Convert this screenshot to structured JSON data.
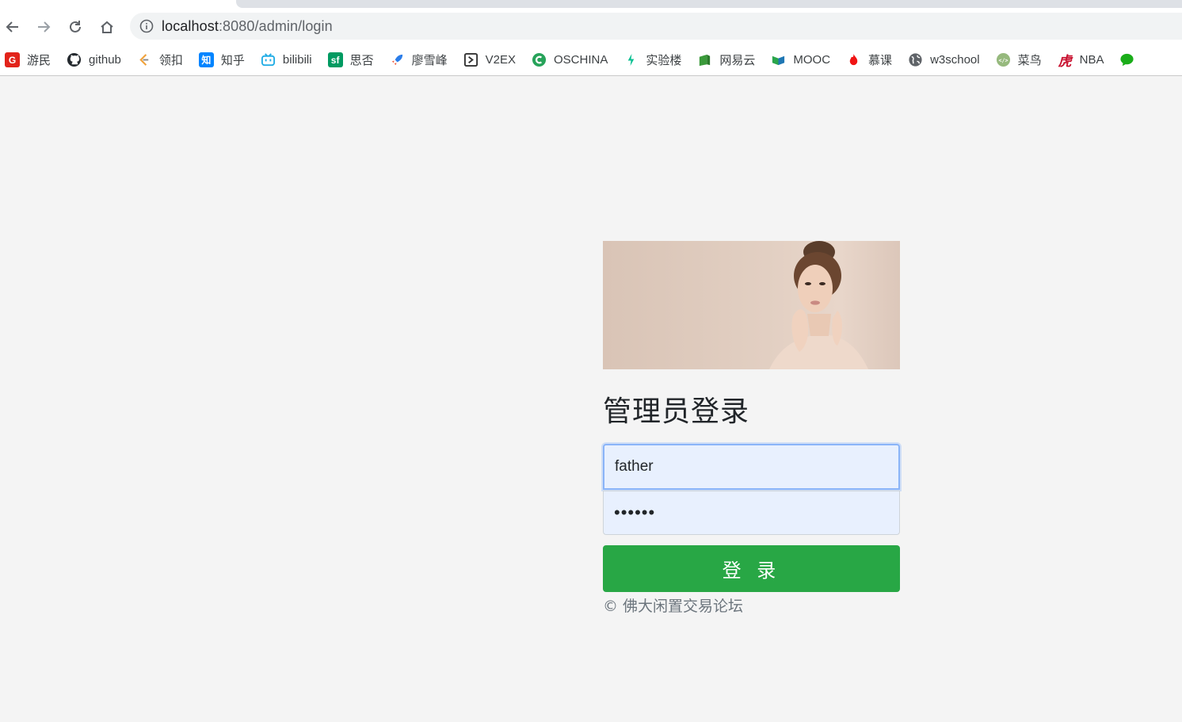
{
  "browser": {
    "url_host": "localhost",
    "url_rest": ":8080/admin/login"
  },
  "bookmarks": [
    {
      "label": "游民",
      "icon": "gamersky-icon",
      "color": "#e2231a",
      "glyph": "G"
    },
    {
      "label": "github",
      "icon": "github-icon",
      "color": "#24292e",
      "glyph": ""
    },
    {
      "label": "领扣",
      "icon": "leetcode-icon",
      "color": "#f0a23b",
      "glyph": ""
    },
    {
      "label": "知乎",
      "icon": "zhihu-icon",
      "color": "#0084ff",
      "glyph": "知"
    },
    {
      "label": "bilibili",
      "icon": "bilibili-icon",
      "color": "#23ade5",
      "glyph": ""
    },
    {
      "label": "思否",
      "icon": "segmentfault-icon",
      "color": "#009a61",
      "glyph": "sf"
    },
    {
      "label": "廖雪峰",
      "icon": "rocket-icon",
      "color": "#2b7de9",
      "glyph": ""
    },
    {
      "label": "V2EX",
      "icon": "v2ex-icon",
      "color": "#333333",
      "glyph": ""
    },
    {
      "label": "OSCHINA",
      "icon": "oschina-icon",
      "color": "#27a35a",
      "glyph": ""
    },
    {
      "label": "实验楼",
      "icon": "shiyanlou-icon",
      "color": "#08bf91",
      "glyph": ""
    },
    {
      "label": "网易云",
      "icon": "netease-cloud-icon",
      "color": "#3a9a3a",
      "glyph": ""
    },
    {
      "label": "MOOC",
      "icon": "mooc-icon",
      "color": "#2aa54b",
      "glyph": ""
    },
    {
      "label": "慕课",
      "icon": "flame-icon",
      "color": "#f01414",
      "glyph": ""
    },
    {
      "label": "w3school",
      "icon": "globe-icon",
      "color": "#5f6368",
      "glyph": ""
    },
    {
      "label": "菜鸟",
      "icon": "runoob-icon",
      "color": "#96b97d",
      "glyph": ""
    },
    {
      "label": "NBA",
      "icon": "hupu-icon",
      "color": "#c8102e",
      "glyph": "虎"
    },
    {
      "label": "",
      "icon": "wechat-icon",
      "color": "#1aad19",
      "glyph": ""
    }
  ],
  "login": {
    "heading": "管理员登录",
    "username_value": "father",
    "password_value": "••••••",
    "submit_label": "登 录",
    "copyright": "© 佛大闲置交易论坛"
  }
}
